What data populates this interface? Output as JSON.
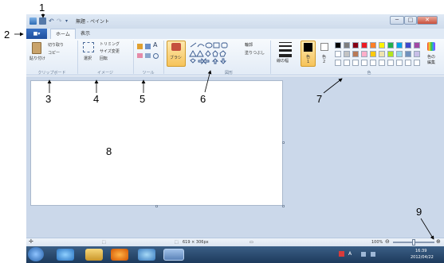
{
  "window": {
    "title": "無題 - ペイント",
    "controls": [
      "─",
      "□",
      "✕"
    ]
  },
  "tabs": {
    "file": "■▾",
    "home": "ホーム",
    "view": "表示"
  },
  "ribbon": {
    "clipboard": {
      "label": "クリップボード",
      "paste": "貼り付け",
      "cut": "切り取り",
      "copy": "コピー"
    },
    "image": {
      "label": "イメージ",
      "select": "選択",
      "crop": "トリミング",
      "resize": "サイズ変更",
      "rotate": "回転"
    },
    "tools": {
      "label": "ツール"
    },
    "brushes": {
      "label": "ブラシ"
    },
    "shapes": {
      "label": "図形",
      "outline": "輪郭",
      "fill": "塗りつぶし"
    },
    "size": {
      "label": "線の幅"
    },
    "colors": {
      "label": "色",
      "color1": "色",
      "color1_num": "1",
      "color2": "色",
      "color2_num": "2",
      "edit": "色の",
      "edit2": "編集",
      "palette": [
        "#000000",
        "#7f7f7f",
        "#880015",
        "#ed1c24",
        "#ff7f27",
        "#fff200",
        "#22b14c",
        "#00a2e8",
        "#3f48cc",
        "#a349a4",
        "#ffffff",
        "#c3c3c3",
        "#b97a57",
        "#ffaec9",
        "#ffc90e",
        "#efe4b0",
        "#b5e61d",
        "#99d9ea",
        "#7092be",
        "#c8bfe7"
      ]
    }
  },
  "statusbar": {
    "dimensions": "619 × 306px",
    "zoom": "100%",
    "zoom_out": "⊖",
    "zoom_in": "⊕"
  },
  "taskbar": {
    "time": "16:39",
    "date": "2012/04/22",
    "lang": "A"
  },
  "annotations": [
    "1",
    "2",
    "3",
    "4",
    "5",
    "6",
    "7",
    "8",
    "9"
  ]
}
